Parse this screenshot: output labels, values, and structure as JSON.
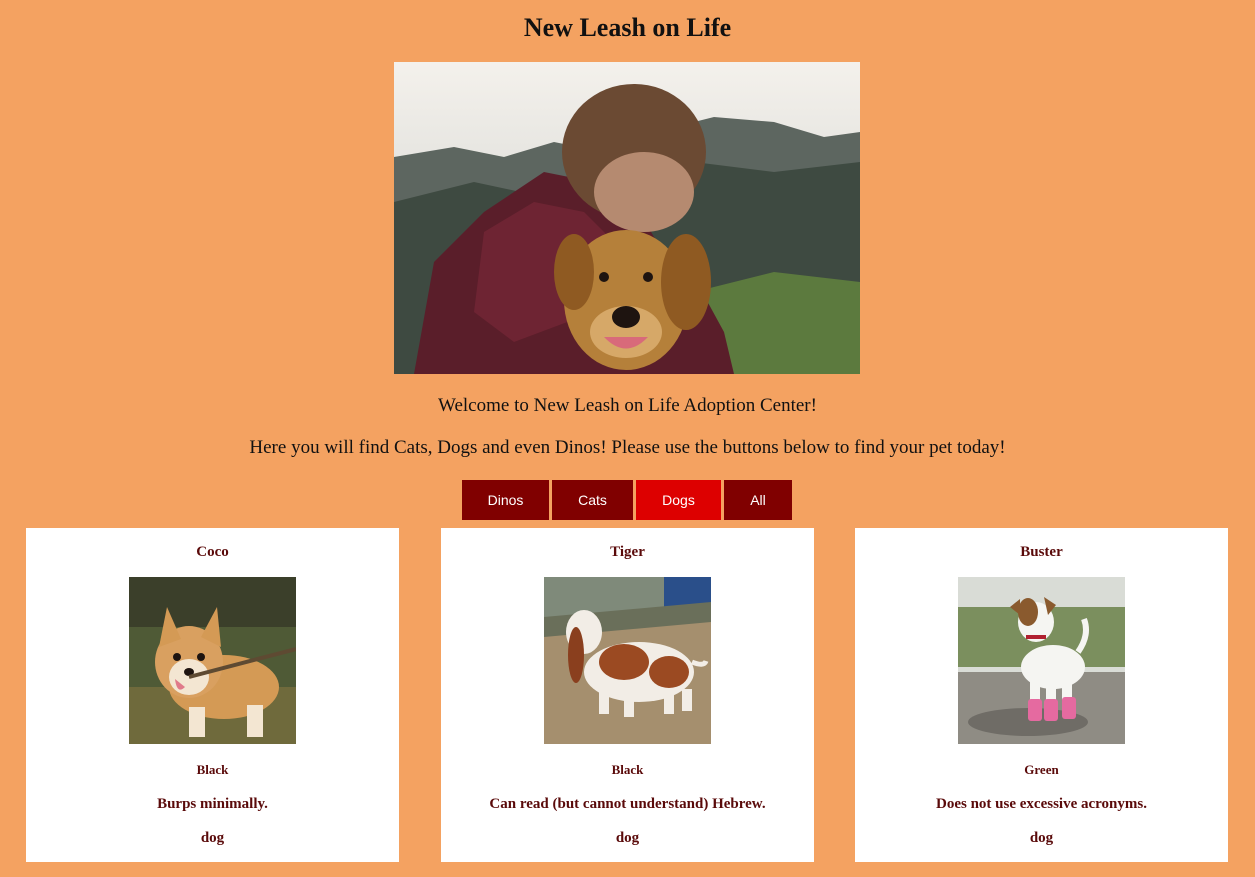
{
  "page": {
    "title": "New Leash on Life",
    "welcome": "Welcome to New Leash on Life Adoption Center!",
    "tagline": "Here you will find Cats, Dogs and even Dinos! Please use the buttons below to find your pet today!"
  },
  "colors": {
    "background": "#f4a261",
    "button": "#800000",
    "button_active": "#dd0000",
    "card_text": "#5a0a0a"
  },
  "filters": {
    "dinos": "Dinos",
    "cats": "Cats",
    "dogs": "Dogs",
    "all": "All",
    "active": "Dogs"
  },
  "pets": [
    {
      "name": "Coco",
      "color": "Black",
      "description": "Burps minimally.",
      "type": "dog",
      "photo": "corgi-with-stick"
    },
    {
      "name": "Tiger",
      "color": "Black",
      "description": "Can read (but cannot understand) Hebrew.",
      "type": "dog",
      "photo": "basset-hound"
    },
    {
      "name": "Buster",
      "color": "Green",
      "description": "Does not use excessive acronyms.",
      "type": "dog",
      "photo": "terrier-in-pink-boots"
    }
  ]
}
